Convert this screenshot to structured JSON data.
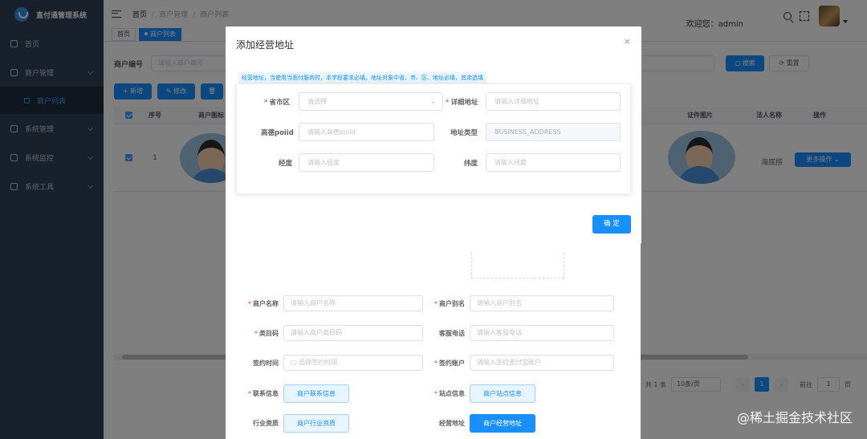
{
  "app": {
    "title": "直付通管理系统"
  },
  "sidebar": {
    "items": [
      {
        "label": "首页"
      },
      {
        "label": "商户管理"
      },
      {
        "label": "商户列表"
      },
      {
        "label": "系统管理"
      },
      {
        "label": "系统监控"
      },
      {
        "label": "系统工具"
      }
    ]
  },
  "navbar": {
    "breadcrumb": [
      "首页",
      "商户管理",
      "商户列表"
    ],
    "welcome": "欢迎您：admin"
  },
  "tags": [
    "首页",
    "商户列表"
  ],
  "filter": {
    "merchant_no_label": "商户编号",
    "merchant_no_placeholder": "请输入商户编号",
    "search_button": "搜索",
    "reset_button": "重置"
  },
  "toolbar": {
    "add": "新增",
    "edit": "修改"
  },
  "table": {
    "headers": [
      "序号",
      "商户图标",
      "证件图片",
      "法人名称",
      "操作"
    ],
    "rows": [
      {
        "index": "1",
        "legal_name": "海底捞",
        "more_action": "更多操作"
      }
    ]
  },
  "pagination": {
    "total": "共 1 条",
    "page_size": "10条/页",
    "current": "1",
    "goto_label": "前往",
    "goto_value": "1",
    "page_unit": "页"
  },
  "under_form": {
    "merchant_name_label": "商户名称",
    "merchant_name_placeholder": "请输入商户名称",
    "merchant_alias_label": "商户别名",
    "merchant_alias_placeholder": "请输入商户别名",
    "category_label": "类目码",
    "category_placeholder": "请输入商户类目码",
    "service_phone_label": "客服电话",
    "service_phone_placeholder": "请输入客服电话",
    "sign_time_label": "签约时间",
    "sign_time_placeholder": "选择签约时间",
    "sign_account_label": "签约账户",
    "sign_account_placeholder": "请输入签约支付宝账户",
    "contact_label": "联系信息",
    "contact_button": "商户联系信息",
    "site_label": "站点信息",
    "site_button": "商户站点信息",
    "industry_label": "行业资质",
    "industry_button": "商户行业资质",
    "address_label": "经营地址",
    "address_button": "商户经营地址"
  },
  "dialog": {
    "title": "添加经营地址",
    "close": "×",
    "tip": "经营地址，当使用当面付服务时，本字段要求必填。地址对象中省、市、区、地址必填，其余选填",
    "province_label": "省市区",
    "province_placeholder": "请选择",
    "detail_label": "详细地址",
    "detail_placeholder": "请输入详细地址",
    "poiid_label": "高德poiid",
    "poiid_placeholder": "请输入高德poiid",
    "type_label": "地址类型",
    "type_value": "BUSINESS_ADDRESS",
    "lng_label": "经度",
    "lng_placeholder": "请输入经度",
    "lat_label": "纬度",
    "lat_placeholder": "请输入纬度",
    "confirm": "确 定"
  },
  "watermark": "@稀土掘金技术社区"
}
